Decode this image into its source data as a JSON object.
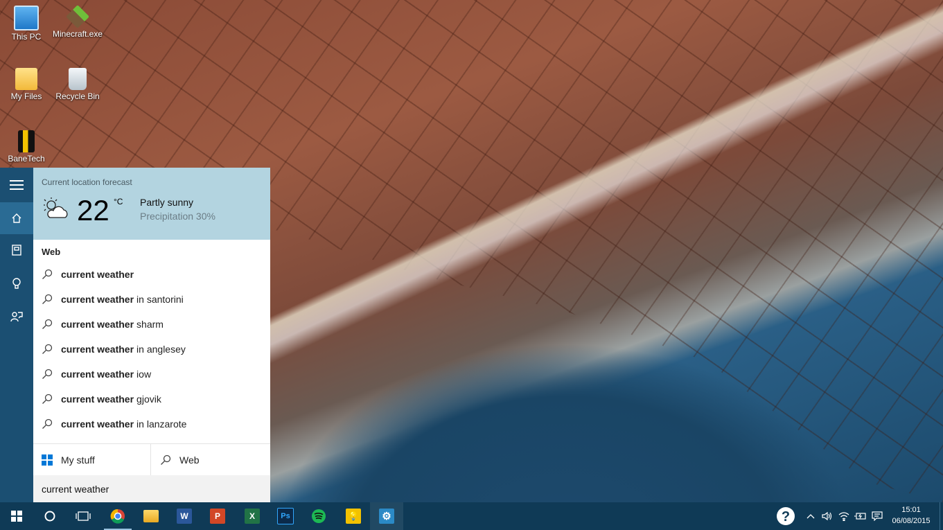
{
  "desktop": {
    "icons": [
      {
        "label": "This PC",
        "icon": "this-pc-icon"
      },
      {
        "label": "Minecraft.exe",
        "icon": "minecraft-icon"
      },
      {
        "label": "My Files",
        "icon": "folder-icon"
      },
      {
        "label": "Recycle Bin",
        "icon": "recycle-bin-icon"
      },
      {
        "label": "BaneTech",
        "icon": "banetech-icon"
      }
    ]
  },
  "cortana": {
    "rail": [
      "hamburger-menu-icon",
      "home-icon",
      "notebook-icon",
      "lightbulb-icon",
      "feedback-icon"
    ],
    "weather": {
      "caption": "Current location forecast",
      "temperature": "22",
      "unit": "°C",
      "condition": "Partly sunny",
      "precipitation": "Precipitation 30%"
    },
    "web_heading": "Web",
    "suggestions": [
      {
        "bold": "current weather",
        "rest": ""
      },
      {
        "bold": "current weather",
        "rest": "in santorini"
      },
      {
        "bold": "current weather",
        "rest": "sharm"
      },
      {
        "bold": "current weather",
        "rest": "in anglesey"
      },
      {
        "bold": "current weather",
        "rest": "iow"
      },
      {
        "bold": "current weather",
        "rest": "gjovik"
      },
      {
        "bold": "current weather",
        "rest": "in lanzarote"
      }
    ],
    "scope": {
      "my_stuff": "My stuff",
      "web": "Web"
    },
    "search_value": "current weather"
  },
  "taskbar": {
    "apps": [
      {
        "name": "chrome",
        "label": "",
        "color": "#dd4b39"
      },
      {
        "name": "file-explorer",
        "label": "",
        "color": "#f2c14e"
      },
      {
        "name": "word",
        "label": "W",
        "color": "#2b579a"
      },
      {
        "name": "powerpoint",
        "label": "P",
        "color": "#d24726"
      },
      {
        "name": "excel",
        "label": "X",
        "color": "#217346"
      },
      {
        "name": "photoshop",
        "label": "Ps",
        "color": "#0b2a4a"
      },
      {
        "name": "spotify",
        "label": "",
        "color": "#1db954"
      },
      {
        "name": "tips",
        "label": "",
        "color": "#f2c200"
      },
      {
        "name": "settings",
        "label": "",
        "color": "#2b8ac6"
      }
    ],
    "time": "15:01",
    "date": "06/08/2015"
  }
}
